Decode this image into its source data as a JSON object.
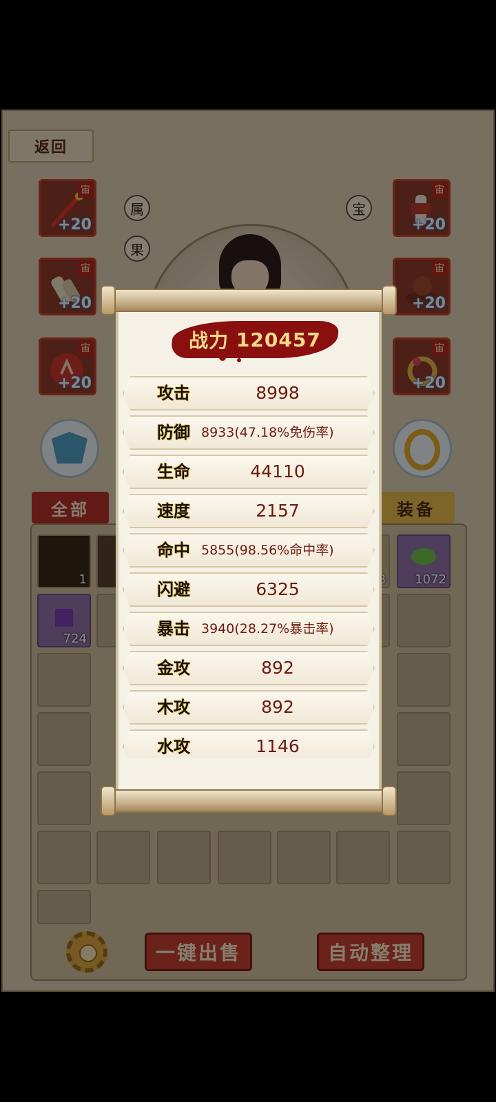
{
  "screen": {
    "back_label": "返回",
    "side_tags": [
      "属",
      "果",
      "宝"
    ],
    "left_slots": [
      {
        "grade": "宙",
        "plus": "+20",
        "icon": "red-sword-icon"
      },
      {
        "grade": "宙",
        "plus": "+20",
        "icon": "scroll-icon"
      },
      {
        "grade": "宙",
        "plus": "+20",
        "icon": "red-shield-icon"
      }
    ],
    "right_slots": [
      {
        "grade": "宙",
        "plus": "+20",
        "icon": "armor-figure-icon"
      },
      {
        "grade": "宙",
        "plus": "+20",
        "icon": "dragon-statue-icon"
      },
      {
        "grade": "宙",
        "plus": "+20",
        "icon": "ring-icon"
      }
    ],
    "tabs": {
      "all": "全部",
      "equip": "装备"
    },
    "inventory_quantities": [
      "1",
      "8",
      "1072",
      "724"
    ],
    "buttons": {
      "sell_all": "一键出售",
      "auto_sort": "自动整理"
    }
  },
  "popup": {
    "power_label": "战力",
    "power_value": "120457",
    "stats": [
      {
        "label": "攻击",
        "value": "8998"
      },
      {
        "label": "防御",
        "value": "8933(47.18%免伤率)"
      },
      {
        "label": "生命",
        "value": "44110"
      },
      {
        "label": "速度",
        "value": "2157"
      },
      {
        "label": "命中",
        "value": "5855(98.56%命中率)"
      },
      {
        "label": "闪避",
        "value": "6325"
      },
      {
        "label": "暴击",
        "value": "3940(28.27%暴击率)"
      },
      {
        "label": "金攻",
        "value": "892"
      },
      {
        "label": "木攻",
        "value": "892"
      },
      {
        "label": "水攻",
        "value": "1146"
      }
    ]
  },
  "colors": {
    "power_band": "#8a1010",
    "power_text": "#f6d989",
    "stat_value": "#6d1a10",
    "tab_all": "#b2302a",
    "tab_equip": "#e3b64a"
  }
}
